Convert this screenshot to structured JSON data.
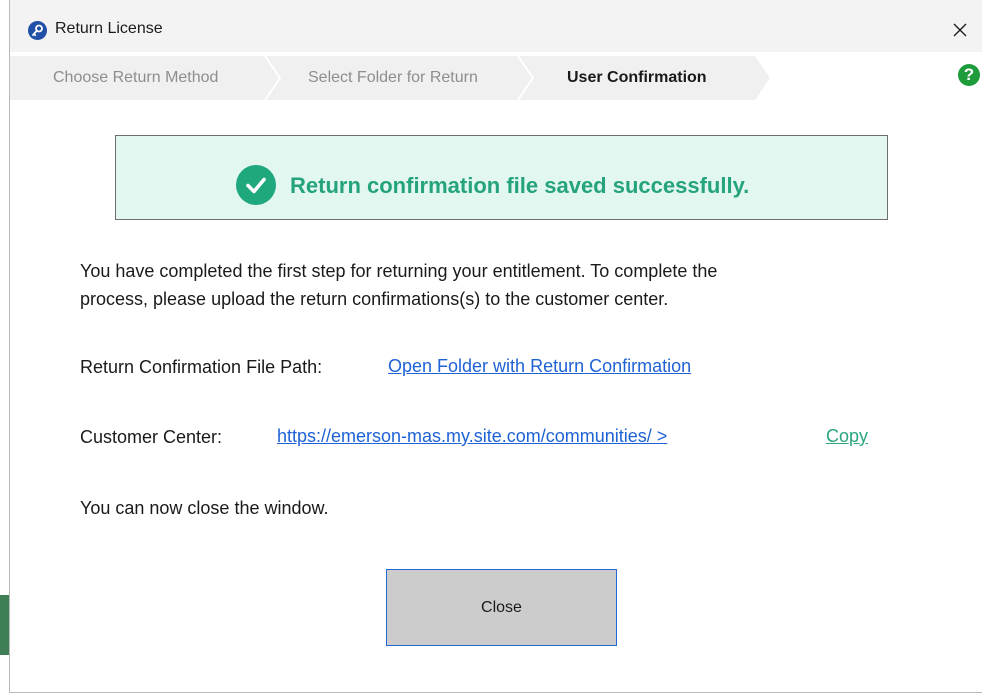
{
  "window": {
    "title": "Return License"
  },
  "steps": [
    {
      "label": "Choose Return Method",
      "state": "inactive"
    },
    {
      "label": "Select Folder for Return",
      "state": "inactive"
    },
    {
      "label": "User Confirmation",
      "state": "active"
    }
  ],
  "banner": {
    "message": "Return confirmation file saved successfully.",
    "icon": "check-circle-icon"
  },
  "content": {
    "intro_line1": "You have completed the first step for returning your entitlement. To complete the",
    "intro_line2": "process, please upload the return confirmations(s) to the customer center.",
    "file_path_label": "Return Confirmation File Path:",
    "file_path_link": "Open Folder with Return Confirmation",
    "customer_center_label": "Customer Center:",
    "customer_center_link": "https://emerson-mas.my.site.com/communities/ >",
    "copy_label": "Copy",
    "close_note": "You can now close the window."
  },
  "buttons": {
    "close_label": "Close"
  },
  "colors": {
    "accent_green": "#24a37c",
    "banner_background": "#e3f7f1",
    "link_blue": "#1f62d6",
    "help_green": "#1e9c3c"
  }
}
